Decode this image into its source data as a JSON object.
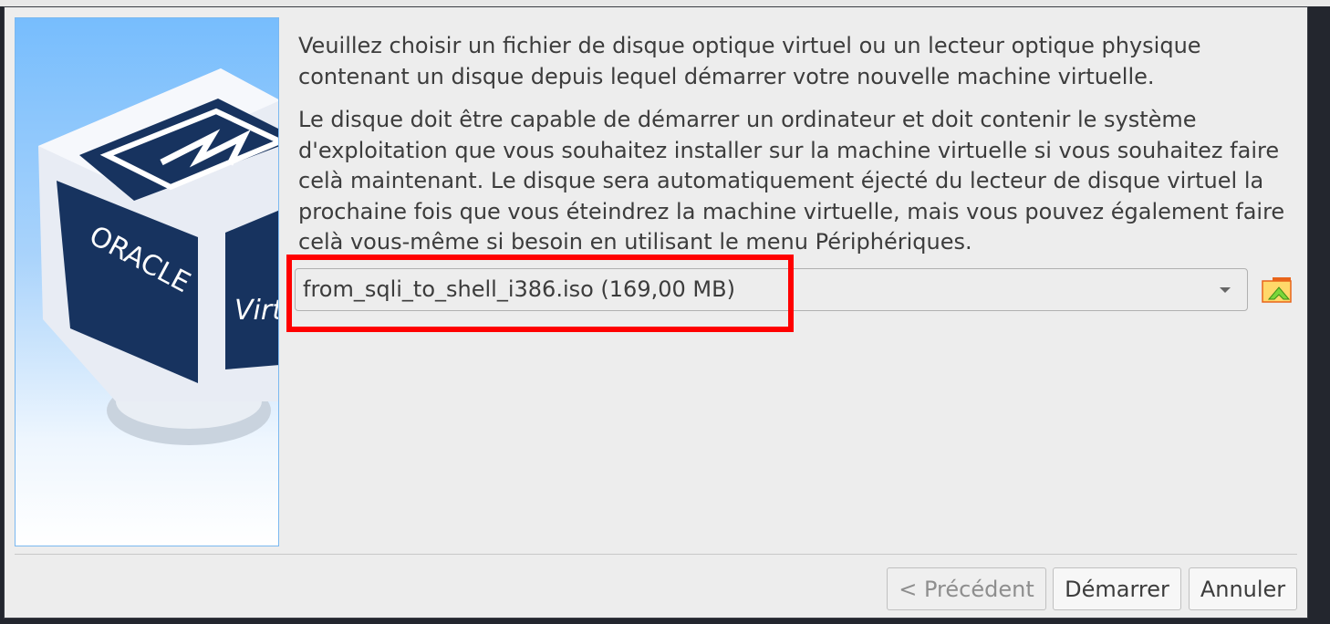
{
  "dialog": {
    "paragraph1": "Veuillez choisir un fichier de disque optique virtuel ou un lecteur optique physique contenant un disque depuis lequel démarrer votre nouvelle machine virtuelle.",
    "paragraph2": "Le disque doit être capable de démarrer un ordinateur et doit contenir le système d'exploitation que vous souhaitez installer sur la machine virtuelle si vous souhaitez faire celà maintenant. Le disque sera automatiquement éjecté du lecteur de disque virtuel la prochaine fois que vous éteindrez la machine virtuelle, mais vous pouvez également faire celà vous-même si besoin en utilisant le menu Périphériques.",
    "disk_selector": {
      "value": "from_sqli_to_shell_i386.iso (169,00 MB)"
    },
    "artwork": {
      "logo_text": "ORACLE",
      "product_text": "Virtual"
    },
    "buttons": {
      "previous": "< Précédent",
      "start": "Démarrer",
      "cancel": "Annuler"
    }
  },
  "colors": {
    "highlight": "#ff0000",
    "background": "#ededed"
  }
}
